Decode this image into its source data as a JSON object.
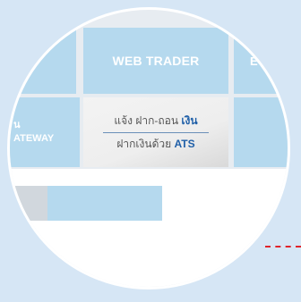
{
  "tiles": {
    "web_trader": "WEB TRADER",
    "right_top_partial": "E",
    "left_mid_line1": "น",
    "left_mid_line2": "ATEWAY"
  },
  "center_panel": {
    "line1_prefix": "แจ้ง ฝาก-ถอน ",
    "line1_bold": "เงิน",
    "line2_prefix": "ฝากเงินด้วย ",
    "line2_bold": "ATS"
  },
  "colors": {
    "tile_blue": "#b5d9ee",
    "accent_blue": "#1f5fa8",
    "dash_red": "#e0242b"
  }
}
